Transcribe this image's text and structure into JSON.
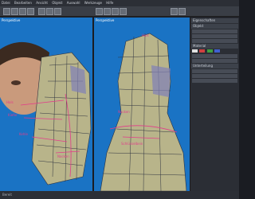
{
  "menu": {
    "items": [
      "Datei",
      "Bearbeiten",
      "Ansicht",
      "Objekt",
      "Auswahl",
      "Werkzeuge",
      "Hilfe"
    ]
  },
  "viewports": {
    "left": {
      "label": "Perspektive"
    },
    "right": {
      "label": "Perspektive"
    }
  },
  "annotations": {
    "left": [
      "Hals",
      "Kiefer",
      "Kehle",
      "Nacken"
    ],
    "right": [
      "Hals",
      "Nacken",
      "Schlüsselbein"
    ]
  },
  "panel": {
    "title": "Eigenschaften",
    "sections": [
      "Objekt",
      "Material",
      "Unterteilung"
    ]
  },
  "status": {
    "text": "Bereit"
  },
  "colors": {
    "viewport_bg": "#1a73c4",
    "annotation": "#e23c8a",
    "mesh_skin": "#b8b48a",
    "mesh_wire": "#2f3340"
  }
}
